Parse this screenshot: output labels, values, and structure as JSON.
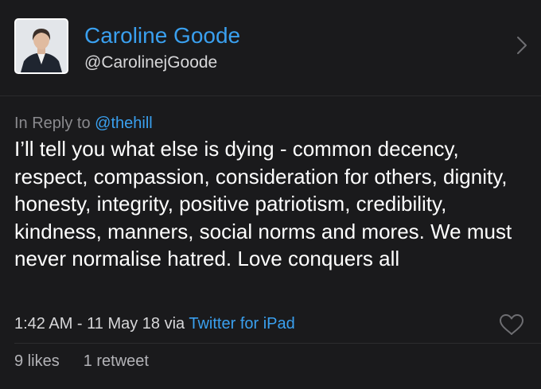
{
  "profile": {
    "display_name": "Caroline Goode",
    "handle": "@CarolinejGoode"
  },
  "tweet": {
    "reply_prefix": "In Reply to ",
    "reply_to": "@thehill",
    "text": "I’ll tell you what else is dying - common decency, respect, compassion, consideration for others, dignity, honesty, integrity, positive patriotism, credibility, kindness, manners, social norms and mores. We must never normalise hatred. Love conquers all",
    "timestamp": "1:42 AM - 11 May 18 via ",
    "source": "Twitter for iPad"
  },
  "stats": {
    "likes": "9 likes",
    "retweets": "1 retweet"
  },
  "icons": {
    "chevron": "chevron-right-icon",
    "like": "heart-outline-icon"
  },
  "colors": {
    "accent": "#3aa0ef",
    "background": "#1a1a1c"
  }
}
